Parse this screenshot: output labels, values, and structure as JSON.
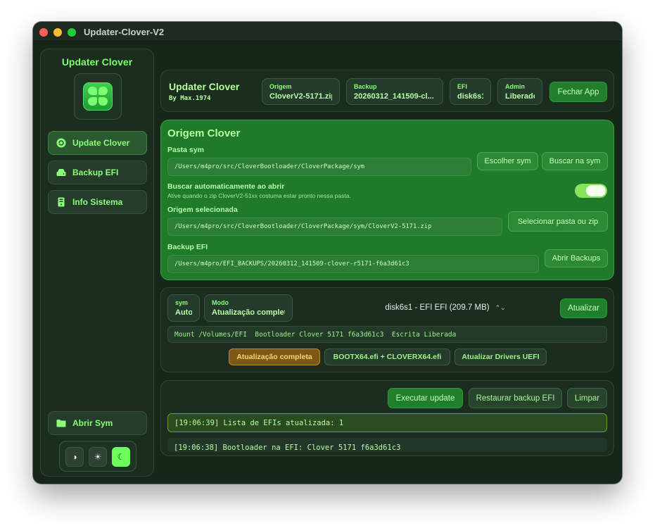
{
  "window": {
    "title": "Updater-Clover-V2"
  },
  "sidebar": {
    "title": "Updater Clover",
    "items": [
      {
        "label": "Update Clover"
      },
      {
        "label": "Backup EFI"
      },
      {
        "label": "Info Sistema"
      }
    ],
    "abrir_sym": "Abrir Sym",
    "theme": {
      "auto_glyph": "◑",
      "light_glyph": "☀",
      "dark_glyph": "☾",
      "selected": "dark"
    }
  },
  "header": {
    "title": "Updater Clover",
    "subtitle": "By Max.1974",
    "chips": [
      {
        "label": "Origem",
        "value": "CloverV2-5171.zip"
      },
      {
        "label": "Backup",
        "value": "20260312_141509-cl..."
      },
      {
        "label": "EFI",
        "value": "disk6s1"
      },
      {
        "label": "Admin",
        "value": "Liberado"
      }
    ],
    "close_label": "Fechar App"
  },
  "origem": {
    "title": "Origem Clover",
    "pasta_sym_label": "Pasta sym",
    "pasta_sym_value": "/Users/m4pro/src/CloverBootloader/CloverPackage/sym",
    "escolher_sym": "Escolher sym",
    "buscar_sym": "Buscar na sym",
    "auto_label": "Buscar automaticamente ao abrir",
    "auto_sub": "Ative quando o zip CloverV2-51xx costuma estar pronto nessa pasta.",
    "auto_on": true,
    "selecionada_label": "Origem selecionada",
    "selecionada_value": "/Users/m4pro/src/CloverBootloader/CloverPackage/sym/CloverV2-5171.zip",
    "selecionar_btn": "Selecionar pasta ou zip",
    "backup_label": "Backup EFI",
    "backup_value": "/Users/m4pro/EFI_BACKUPS/20260312_141509-clover-r5171-f6a3d61c3",
    "abrir_backups": "Abrir Backups"
  },
  "target": {
    "sym_chip": {
      "label": "sym",
      "value": "Auto"
    },
    "modo_chip": {
      "label": "Modo",
      "value": "Atualização completa"
    },
    "disk_select": "disk6s1 - EFI EFI (209.7 MB)",
    "atualizar": "Atualizar",
    "mount_info": "Mount /Volumes/EFI  Bootloader Clover 5171 f6a3d61c3  Escrita Liberada",
    "modes": [
      "Atualização completa",
      "BOOTX64.efi + CLOVERX64.efi",
      "Atualizar Drivers UEFI"
    ],
    "active_mode": 0
  },
  "actions": {
    "executar": "Executar update",
    "restaurar": "Restaurar backup EFI",
    "limpar": "Limpar"
  },
  "log": [
    "[19:06:39] Lista de EFIs atualizada: 1",
    "[19:06:38] Bootloader na EFI: Clover 5171 f6a3d61c3"
  ]
}
